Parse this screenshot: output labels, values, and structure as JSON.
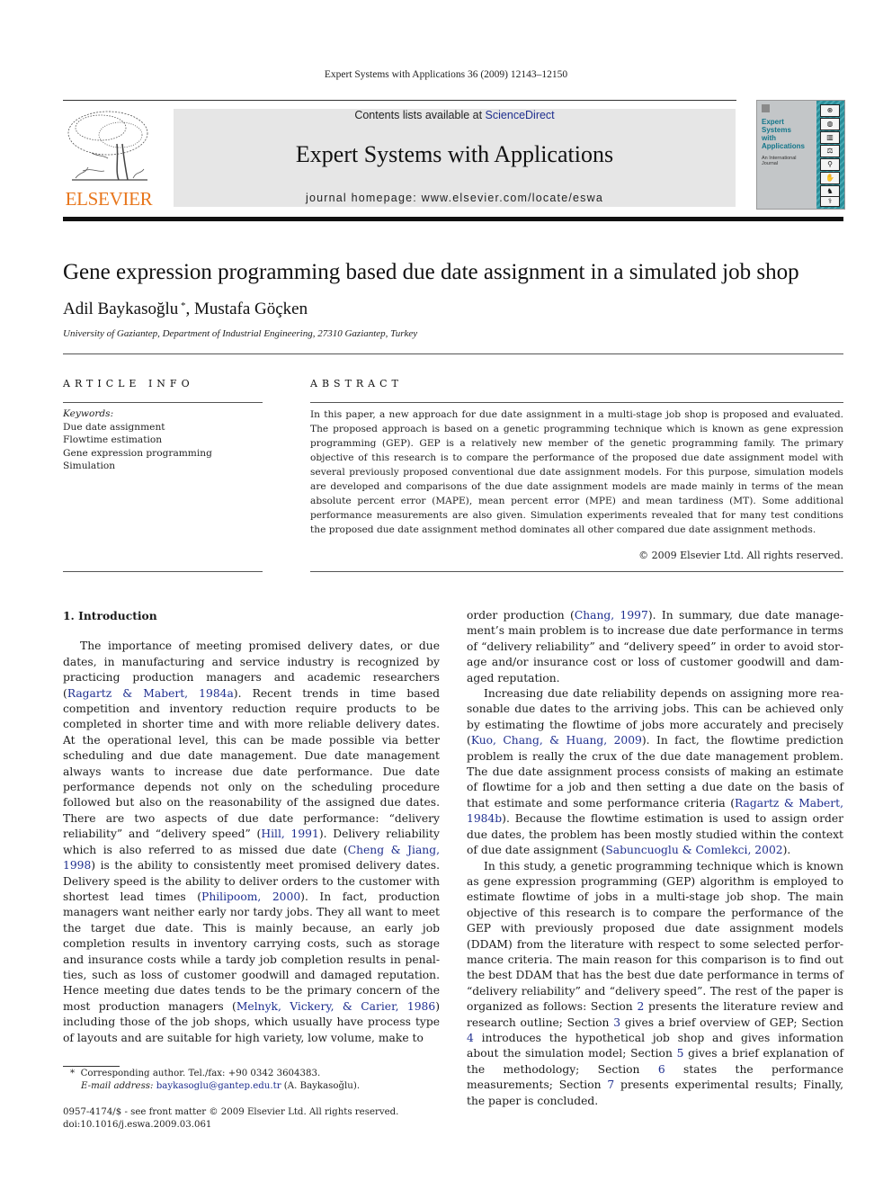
{
  "running_head": "Expert Systems with Applications 36 (2009) 12143–12150",
  "publisher": {
    "wordmark": "ELSEVIER",
    "logo_icon": "tree-logo",
    "brand_color": "#e8761c"
  },
  "masthead": {
    "contents_prefix": "Contents lists available at ",
    "contents_link": "ScienceDirect",
    "journal_title": "Expert Systems with Applications",
    "homepage": "journal homepage: www.elsevier.com/locate/eswa",
    "background": "#e6e6e6"
  },
  "cover": {
    "title_lines": [
      "Expert",
      "Systems",
      "with",
      "Applications"
    ],
    "subtitle_lines": [
      "An International",
      "Journal"
    ],
    "title_color": "#13768a",
    "icons": [
      "steering-wheel-icon",
      "globe-icon",
      "bar-chart-icon",
      "scales-icon",
      "microscope-icon",
      "handshake-icon",
      "chess-icon",
      "caduceus-icon"
    ]
  },
  "article": {
    "title": "Gene expression programming based due date assignment in a simulated job shop",
    "authors": [
      {
        "name": "Adil Baykasoğlu",
        "mark": "*"
      },
      {
        "name": "Mustafa Göçken",
        "mark": ""
      }
    ],
    "author_separator": ", ",
    "affiliation": "University of Gaziantep, Department of Industrial Engineering, 27310 Gaziantep, Turkey"
  },
  "article_info": {
    "heading": "ARTICLE INFO",
    "keywords_label": "Keywords:",
    "keywords": [
      "Due date assignment",
      "Flowtime estimation",
      "Gene expression programming",
      "Simulation"
    ]
  },
  "abstract": {
    "heading": "ABSTRACT",
    "text": "In this paper, a new approach for due date assignment in a multi-stage job shop is proposed and evaluated. The proposed approach is based on a genetic programming technique which is known as gene expression programming (GEP). GEP is a relatively new member of the genetic programming family. The primary objective of this research is to compare the performance of the proposed due date assignment model with several previously proposed conventional due date assignment models. For this purpose, simulation models are developed and comparisons of the due date assignment models are made mainly in terms of the mean absolute percent error (MAPE), mean percent error (MPE) and mean tardiness (MT). Some additional performance measurements are also given. Simulation experiments revealed that for many test conditions the proposed due date assignment method dominates all other compared due date assignment methods.",
    "copyright": "© 2009 Elsevier Ltd. All rights reserved."
  },
  "body": {
    "section_heading": "1. Introduction",
    "paragraphs": [
      {
        "indent": true,
        "segments": [
          {
            "t": "The importance of meeting promised delivery dates, or due dates, in manufacturing and service industry is recognized by prac­ticing production managers and academic researchers ("
          },
          {
            "t": "Ragartz & Mabert, 1984a",
            "link": true
          },
          {
            "t": "). Recent trends in time based competition and inventory reduction require products to be completed in shorter time and with more reliable delivery dates. At the operational le­vel, this can be made possible via better scheduling and due date management. Due date management always wants to increase due date performance. Due date performance depends not only on the scheduling procedure followed but also on the reasonability of the assigned due dates. There are two aspects of due date perfor­mance: “delivery reliability” and “delivery speed” ("
          },
          {
            "t": "Hill, 1991",
            "link": true
          },
          {
            "t": "). Delivery reliability which is also referred to as missed due date ("
          },
          {
            "t": "Cheng & Jiang, 1998",
            "link": true
          },
          {
            "t": ") is the ability to consistently meet promised delivery dates. Delivery speed is the ability to deliver orders to the customer with shortest lead times ("
          },
          {
            "t": "Philipoom, 2000",
            "link": true
          },
          {
            "t": "). In fact, pro­duction managers want neither early nor tardy jobs. They all want to meet the target due date. This is mainly because, an early job completion results in inventory carrying costs, such as storage and insurance costs while a tardy job completion results in penal­ties, such as loss of customer goodwill and damaged reputation. Hence meeting due dates tends to be the primary concern of the most production managers ("
          },
          {
            "t": "Melnyk, Vickery, & Carier, 1986",
            "link": true
          },
          {
            "t": ") including those of the job shops, which usually have process type of layouts and are suitable for high variety, low volume, make to order production ("
          },
          {
            "t": "Chang, 1997",
            "link": true
          },
          {
            "t": "). In summary, due date manage­ment’s main problem is to increase due date performance in terms of “delivery reliability” and “delivery speed” in order to avoid stor­age and/or insurance cost or loss of customer goodwill and dam­aged reputation."
          }
        ]
      },
      {
        "indent": true,
        "segments": [
          {
            "t": "Increasing due date reliability depends on assigning more rea­sonable due dates to the arriving jobs. This can be achieved only by estimating the flowtime of jobs more accurately and precisely ("
          },
          {
            "t": "Kuo, Chang, & Huang, 2009",
            "link": true
          },
          {
            "t": "). In fact, the flowtime prediction prob­lem is really the crux of the due date management problem. The due date assignment process consists of making an estimate of flowtime for a job and then setting a due date on the basis of that estimate and some performance criteria ("
          },
          {
            "t": "Ragartz & Mabert, 1984b",
            "link": true
          },
          {
            "t": "). Because the flowtime estimation is used to assign order due dates, the problem has been mostly studied within the context of due date assignment ("
          },
          {
            "t": "Sabuncuoglu & Comlekci, 2002",
            "link": true
          },
          {
            "t": ")."
          }
        ]
      },
      {
        "indent": true,
        "segments": [
          {
            "t": "In this study, a genetic programming technique which is known as gene expression programming (GEP) algorithm is employed to estimate flowtime of jobs in a multi-stage job shop. The main objective of this research is to compare the performance of the GEP with previously proposed due date assignment models (DDAM) from the literature with respect to some selected perfor­mance criteria. The main reason for this comparison is to find out the best DDAM that has the best due date performance in terms of “delivery reliability” and “delivery speed”. The rest of the paper is organized as follows: Section "
          },
          {
            "t": "2",
            "link": true
          },
          {
            "t": " presents the literature review and research outline; Section "
          },
          {
            "t": "3",
            "link": true
          },
          {
            "t": " gives a brief overview of GEP; Section "
          },
          {
            "t": "4",
            "link": true
          },
          {
            "t": " introduces the hypothetical job shop and gives information about the simulation model; Section "
          },
          {
            "t": "5",
            "link": true
          },
          {
            "t": " gives a brief explanation of the methodology; Section "
          },
          {
            "t": "6",
            "link": true
          },
          {
            "t": " states the performance measurements; Section "
          },
          {
            "t": "7",
            "link": true
          },
          {
            "t": " presents experimental results; Finally, the paper is concluded."
          }
        ]
      }
    ]
  },
  "footnote": {
    "mark": "*",
    "line1": "Corresponding author. Tel./fax: +90 0342 3604383.",
    "email_label": "E-mail address:",
    "email": "baykasoglu@gantep.edu.tr",
    "email_suffix": " (A. Baykasoğlu)."
  },
  "issn_line": "0957-4174/$ - see front matter © 2009 Elsevier Ltd. All rights reserved.",
  "doi": "doi:10.1016/j.eswa.2009.03.061",
  "link_color": "#1f2f8f"
}
